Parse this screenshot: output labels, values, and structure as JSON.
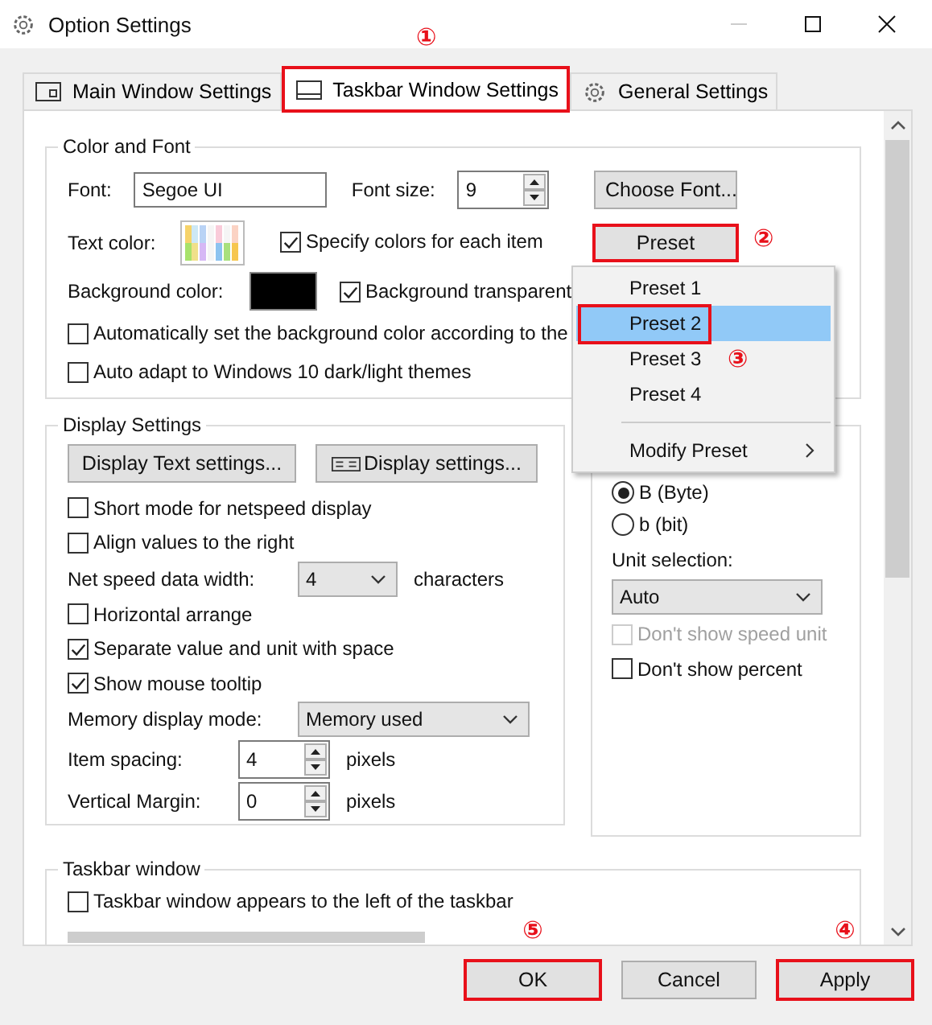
{
  "window": {
    "title": "Option Settings"
  },
  "tabs": [
    {
      "label": "Main Window Settings",
      "selected": false,
      "highlighted": false
    },
    {
      "label": "Taskbar Window Settings",
      "selected": true,
      "highlighted": true,
      "callout": "①"
    },
    {
      "label": "General Settings",
      "selected": false,
      "highlighted": false
    }
  ],
  "color_and_font": {
    "title": "Color and Font",
    "font_label": "Font:",
    "font_value": "Segoe UI",
    "font_size_label": "Font size:",
    "font_size_value": "9",
    "choose_font_button": "Choose Font...",
    "text_color_label": "Text color:",
    "specify_colors": {
      "label": "Specify colors for each item",
      "checked": true
    },
    "preset_button": {
      "label": "Preset",
      "highlighted": true,
      "callout": "②"
    },
    "background_color_label": "Background color:",
    "background_transparent": {
      "label": "Background transparent",
      "checked": true
    },
    "auto_background": {
      "label": "Automatically set the background color according to the",
      "checked": false
    },
    "auto_adapt": {
      "label": "Auto adapt to Windows 10 dark/light themes",
      "checked": false
    }
  },
  "display_settings": {
    "title": "Display Settings",
    "buttons": [
      "Display Text settings...",
      "Display settings..."
    ],
    "rows": [
      {
        "kind": "checkbox",
        "label": "Short mode for netspeed display",
        "checked": false
      },
      {
        "kind": "checkbox",
        "label": "Align values to the right",
        "checked": false
      },
      {
        "kind": "select",
        "label": "Net speed data width:",
        "value": "4",
        "suffix": "characters"
      },
      {
        "kind": "checkbox",
        "label": "Horizontal arrange",
        "checked": false
      },
      {
        "kind": "checkbox",
        "label": "Separate value and unit with space",
        "checked": true
      },
      {
        "kind": "checkbox",
        "label": "Show mouse tooltip",
        "checked": true
      },
      {
        "kind": "select",
        "label": "Memory display mode:",
        "value": "Memory used"
      },
      {
        "kind": "spin",
        "label": "Item spacing:",
        "value": "4",
        "suffix": "pixels"
      },
      {
        "kind": "spin",
        "label": "Vertical Margin:",
        "value": "0",
        "suffix": "pixels"
      }
    ]
  },
  "netspeed_unit": {
    "options": [
      {
        "label": "B (Byte)",
        "selected": true
      },
      {
        "label": "b (bit)",
        "selected": false
      }
    ],
    "unit_selection_label": "Unit selection:",
    "unit_selection_value": "Auto",
    "hide_speed_unit": {
      "label": "Don't show speed unit",
      "checked": false,
      "disabled": true
    },
    "hide_percent": {
      "label": "Don't show percent",
      "checked": false,
      "disabled": false
    }
  },
  "taskbar_window": {
    "title": "Taskbar window",
    "left_of_taskbar": {
      "label": "Taskbar window appears to the left of the taskbar",
      "checked": false
    }
  },
  "preset_menu": {
    "items": [
      {
        "label": "Preset 1",
        "selected": false,
        "highlighted": false
      },
      {
        "label": "Preset 2",
        "selected": true,
        "highlighted": true,
        "callout": "③"
      },
      {
        "label": "Preset 3",
        "selected": false,
        "highlighted": false
      },
      {
        "label": "Preset 4",
        "selected": false,
        "highlighted": false
      }
    ],
    "submenu_item": "Modify Preset"
  },
  "buttons": [
    {
      "label": "OK",
      "highlighted": true,
      "callout": "⑤"
    },
    {
      "label": "Cancel",
      "highlighted": false
    },
    {
      "label": "Apply",
      "highlighted": true,
      "callout": "④"
    }
  ]
}
